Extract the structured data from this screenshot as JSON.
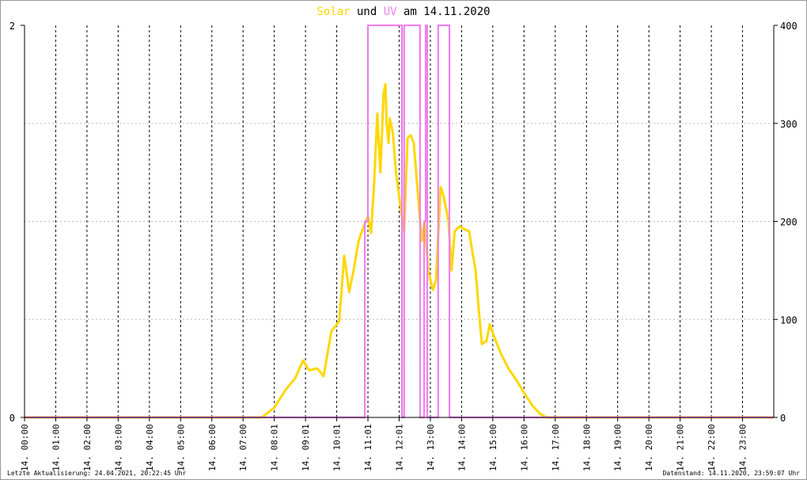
{
  "chart_data": {
    "type": "line",
    "title": {
      "part1": "Solar",
      "part2": " und ",
      "part3": "UV",
      "part4": " am 14.11.2020"
    },
    "x_unit": "hour of day",
    "xlim": [
      0,
      24
    ],
    "x_tick_labels": [
      "14. 00:00",
      "14. 01:00",
      "14. 02:00",
      "14. 03:00",
      "14. 04:00",
      "14. 05:00",
      "14. 06:00",
      "14. 07:00",
      "14. 08:01",
      "14. 09:01",
      "14. 10:01",
      "14. 11:01",
      "14. 12:01",
      "14. 13:00",
      "14. 14:00",
      "14. 15:00",
      "14. 16:00",
      "14. 17:00",
      "14. 18:00",
      "14. 19:00",
      "14. 20:00",
      "14. 21:00",
      "14. 22:00",
      "14. 23:00"
    ],
    "y_left": {
      "lim": [
        0,
        2
      ],
      "ticks": [
        "0",
        "2"
      ]
    },
    "y_right": {
      "lim": [
        0,
        400
      ],
      "ticks": [
        "0",
        "100",
        "200",
        "300",
        "400"
      ]
    },
    "grid": true,
    "series": [
      {
        "name": "Solar",
        "axis": "right",
        "color": "#ffd700",
        "points": [
          [
            0,
            0
          ],
          [
            7.6,
            0
          ],
          [
            8.0,
            10
          ],
          [
            8.36,
            28
          ],
          [
            8.67,
            40
          ],
          [
            8.92,
            58
          ],
          [
            9.12,
            48
          ],
          [
            9.38,
            50
          ],
          [
            9.58,
            42
          ],
          [
            9.83,
            88
          ],
          [
            10.08,
            98
          ],
          [
            10.24,
            165
          ],
          [
            10.4,
            128
          ],
          [
            10.54,
            150
          ],
          [
            10.7,
            180
          ],
          [
            10.9,
            198
          ],
          [
            11.0,
            205
          ],
          [
            11.1,
            188
          ],
          [
            11.2,
            240
          ],
          [
            11.3,
            310
          ],
          [
            11.4,
            250
          ],
          [
            11.5,
            330
          ],
          [
            11.56,
            340
          ],
          [
            11.6,
            300
          ],
          [
            11.66,
            280
          ],
          [
            11.7,
            305
          ],
          [
            11.8,
            290
          ],
          [
            11.9,
            250
          ],
          [
            12.06,
            210
          ],
          [
            12.16,
            190
          ],
          [
            12.27,
            285
          ],
          [
            12.37,
            288
          ],
          [
            12.47,
            280
          ],
          [
            12.62,
            220
          ],
          [
            12.72,
            180
          ],
          [
            12.82,
            200
          ],
          [
            12.93,
            150
          ],
          [
            13.08,
            130
          ],
          [
            13.18,
            140
          ],
          [
            13.33,
            235
          ],
          [
            13.43,
            225
          ],
          [
            13.58,
            200
          ],
          [
            13.68,
            150
          ],
          [
            13.78,
            190
          ],
          [
            13.94,
            195
          ],
          [
            14.09,
            192
          ],
          [
            14.24,
            190
          ],
          [
            14.34,
            170
          ],
          [
            14.45,
            150
          ],
          [
            14.55,
            110
          ],
          [
            14.65,
            75
          ],
          [
            14.8,
            78
          ],
          [
            14.9,
            95
          ],
          [
            15.05,
            82
          ],
          [
            15.26,
            65
          ],
          [
            15.5,
            50
          ],
          [
            15.76,
            38
          ],
          [
            16.0,
            25
          ],
          [
            16.27,
            12
          ],
          [
            16.5,
            4
          ],
          [
            16.72,
            0
          ]
        ]
      },
      {
        "name": "UV",
        "axis": "left",
        "color": "#ee82ee",
        "points": [
          [
            0,
            0
          ],
          [
            10.9,
            0
          ],
          [
            10.9,
            1
          ],
          [
            11.0,
            1
          ],
          [
            11.0,
            2
          ],
          [
            12.09,
            2
          ],
          [
            12.09,
            0
          ],
          [
            12.16,
            0
          ],
          [
            12.16,
            2
          ],
          [
            12.67,
            2
          ],
          [
            12.67,
            0
          ],
          [
            12.8,
            0
          ],
          [
            12.8,
            1
          ],
          [
            12.85,
            1
          ],
          [
            12.85,
            2
          ],
          [
            12.9,
            2
          ],
          [
            12.9,
            0
          ],
          [
            13.25,
            0
          ],
          [
            13.25,
            2
          ],
          [
            13.61,
            2
          ],
          [
            13.61,
            0
          ],
          [
            24,
            0
          ]
        ]
      }
    ]
  },
  "footer": {
    "last_update": "Letzte Aktualisierung: 24.04.2021, 20:22:45 Uhr",
    "data_status": "Datenstand: 14.11.2020, 23:59:07 Uhr"
  }
}
